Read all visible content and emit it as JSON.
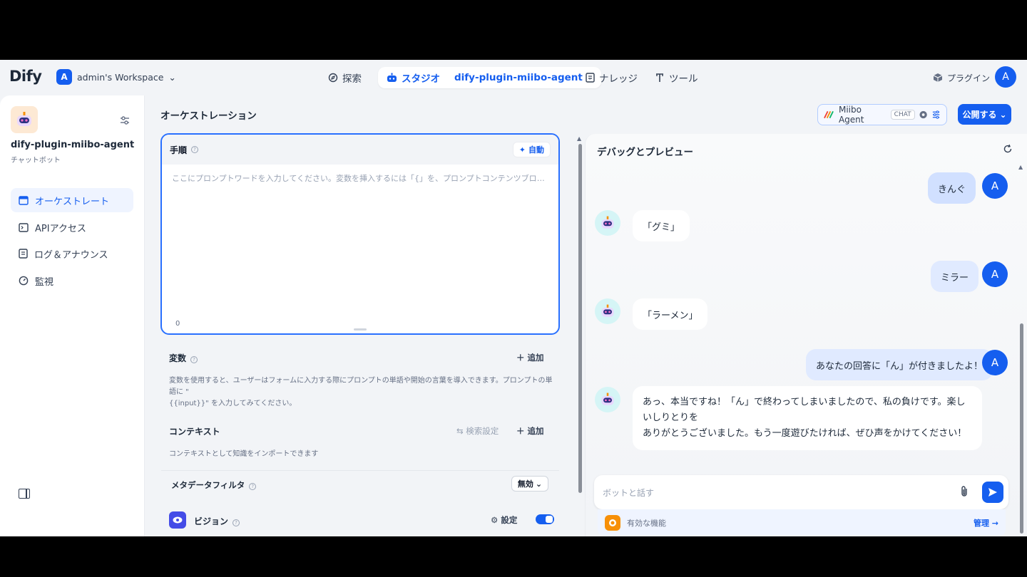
{
  "header": {
    "logo": "Dify",
    "workspace_initial": "A",
    "workspace_name": "admin's Workspace",
    "nav": {
      "explore": "探索",
      "studio": "スタジオ",
      "app_name": "dify-plugin-miibo-agent",
      "knowledge": "ナレッジ",
      "tools": "ツール",
      "plugins": "プラグイン"
    },
    "user_initial": "A"
  },
  "sidebar": {
    "app_name": "dify-plugin-miibo-agent",
    "app_type": "チャットボット",
    "items": [
      {
        "label": "オーケストレート",
        "icon": "layout-icon"
      },
      {
        "label": "APIアクセス",
        "icon": "terminal-icon"
      },
      {
        "label": "ログ＆アナウンス",
        "icon": "file-list-icon"
      },
      {
        "label": "監視",
        "icon": "dashboard-icon"
      }
    ]
  },
  "main": {
    "title": "オーケストレーション",
    "agent": {
      "label": "Miibo Agent",
      "tag": "CHAT"
    },
    "publish_label": "公開する",
    "prompt": {
      "title": "手順",
      "auto_label": "自動",
      "placeholder": "ここにプロンプトワードを入力してください。変数を挿入するには「{」を、プロンプトコンテンツブロックを挿入するには...",
      "count": "0"
    },
    "variables": {
      "title": "変数",
      "add_label": "追加",
      "desc_line1": "変数を使用すると、ユーザーはフォームに入力する際にプロンプトの単語や開始の言葉を導入できます。プロンプトの単語に \"",
      "desc_line2": "{{input}}\" を入力してみてください。"
    },
    "context": {
      "title": "コンテキスト",
      "retrieval_label": "検索設定",
      "add_label": "追加",
      "desc": "コンテキストとして知識をインポートできます",
      "metadata_label": "メタデータフィルタ",
      "metadata_value": "無効"
    },
    "vision": {
      "title": "ビジョン",
      "settings_label": "設定",
      "enabled": true
    }
  },
  "debug": {
    "title": "デバッグとプレビュー",
    "messages": [
      {
        "role": "user",
        "text": "きんぐ"
      },
      {
        "role": "bot",
        "text": "「グミ」"
      },
      {
        "role": "user",
        "text": "ミラー"
      },
      {
        "role": "bot",
        "text": "「ラーメン」"
      },
      {
        "role": "user",
        "text": "あなたの回答に「ん」が付きましたよ！"
      },
      {
        "role": "bot",
        "line1": "あっ、本当ですね！「ん」で終わってしまいましたので、私の負けです。楽しいしりとりを",
        "line2": "ありがとうございました。もう一度遊びたければ、ぜひ声をかけてください！"
      }
    ],
    "user_initial": "A",
    "input_placeholder": "ボットと話す",
    "features_label": "有効な機能",
    "manage_label": "管理"
  },
  "colors": {
    "accent": "#155eef",
    "active_bg": "#eff4ff",
    "user_bubble": "#d1e0ff"
  }
}
